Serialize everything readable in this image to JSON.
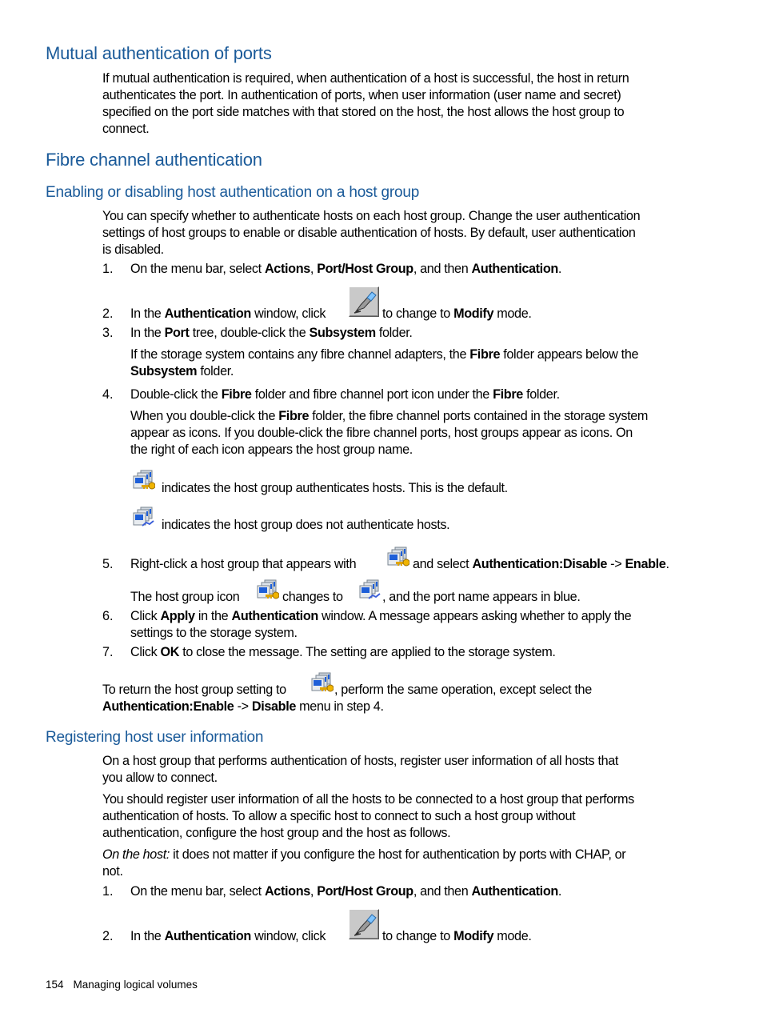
{
  "sections": {
    "mutual": {
      "title": "Mutual authentication of ports",
      "lines": [
        "If mutual authentication is required, when authentication of a host is successful, the host in return",
        "authenticates the port. In authentication of ports, when user information (user name and secret)",
        "specified on the port side matches with that stored on the host, the host allows the host group to",
        "connect."
      ]
    },
    "fibre": {
      "title": "Fibre channel authentication"
    },
    "enabling": {
      "title": "Enabling or disabling host authentication on a host group",
      "intro": [
        "You can specify whether to authenticate hosts on each host group. Change the user authentication",
        "settings of host groups to enable or disable authentication of hosts. By default, user authentication",
        "is disabled."
      ],
      "step1": {
        "num": "1.",
        "pre": "On the menu bar, select ",
        "b1": "Actions",
        "sep1": ", ",
        "b2": "Port/Host Group",
        "sep2": ", and then ",
        "b3": "Authentication",
        "post": "."
      },
      "step2": {
        "num": "2.",
        "pre": "In the ",
        "b1": "Authentication",
        "mid": " window, click",
        "after": " to change to ",
        "b2": "Modify",
        "post": " mode."
      },
      "step3": {
        "num": "3.",
        "pre": "In the ",
        "b1": "Port",
        "mid": " tree, double-click the ",
        "b2": "Subsystem",
        "post": " folder."
      },
      "step3_note": {
        "pre": "If the storage system contains any fibre channel adapters, the ",
        "b1": "Fibre",
        "mid": " folder appears below the",
        "b2": "Subsystem",
        "post": " folder."
      },
      "step4": {
        "num": "4.",
        "pre": "Double-click the ",
        "b1": "Fibre",
        "mid": " folder and fibre channel port icon under the ",
        "b2": "Fibre",
        "post": " folder."
      },
      "step4_note": {
        "l1_pre": "When you double-click the ",
        "l1_b": "Fibre",
        "l1_post": " folder, the fibre channel ports contained in the storage system",
        "l2": "appear as icons. If you double-click the fibre channel ports, host groups appear as icons. On",
        "l3": "the right of each icon appears the host group name."
      },
      "icon_auth_text": "indicates the host group authenticates hosts. This is the default.",
      "icon_noauth_text": "indicates the host group does not authenticate hosts.",
      "step5": {
        "num": "5.",
        "pre": "Right-click a host group that appears with",
        "mid": " and select ",
        "b1": "Authentication:Disable",
        "arrow": " -> ",
        "b2": "Enable",
        "post": "."
      },
      "step5_note": {
        "pre": "The host group icon",
        "mid": " changes to",
        "post": ", and the port name appears in blue."
      },
      "step6": {
        "num": "6.",
        "pre": "Click ",
        "b1": "Apply",
        "mid": " in the ",
        "b2": "Authentication",
        "post": " window. A message appears asking whether to apply the",
        "l2": "settings to the storage system."
      },
      "step7": {
        "num": "7.",
        "pre": "Click ",
        "b1": "OK",
        "post": " to close the message. The setting are applied to the storage system."
      },
      "return": {
        "pre": "To return the host group setting to",
        "post": ", perform the same operation, except select the",
        "b1": "Authentication:Enable",
        "arrow": " -> ",
        "b2": "Disable",
        "end": " menu in step 4."
      }
    },
    "registering": {
      "title": "Registering host user information",
      "p1": [
        "On a host group that performs authentication of hosts, register user information of all hosts that",
        "you allow to connect."
      ],
      "p2": [
        "You should register user information of all the hosts to be connected to a host group that performs",
        "authentication of hosts. To allow a specific host to connect to such a host group without",
        "authentication, configure the host group and the host as follows."
      ],
      "p3": {
        "em": "On the host:",
        "rest": " it does not matter if you configure the host for authentication by ports with CHAP, or",
        "l2": "not."
      },
      "step1": {
        "num": "1.",
        "pre": "On the menu bar, select ",
        "b1": "Actions",
        "sep1": ", ",
        "b2": "Port/Host Group",
        "sep2": ", and then ",
        "b3": "Authentication",
        "post": "."
      },
      "step2": {
        "num": "2.",
        "pre": "In the ",
        "b1": "Authentication",
        "mid": " window, click",
        "after": " to change to ",
        "b2": "Modify",
        "post": " mode."
      }
    }
  },
  "footer": {
    "page_number": "154",
    "chapter": "Managing logical volumes"
  },
  "icons": {
    "modify": "modify-pen-icon",
    "host_group_auth": "host-group-authenticated-icon",
    "host_group_noauth": "host-group-unauthenticated-icon"
  },
  "colors": {
    "heading": "#1a5a99"
  }
}
